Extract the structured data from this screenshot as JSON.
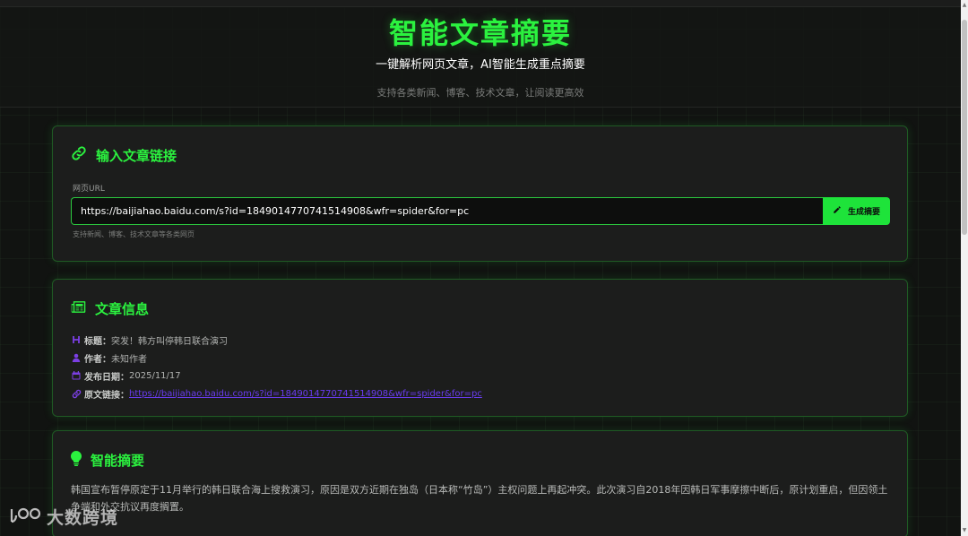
{
  "hero": {
    "title": "智能文章摘要",
    "subtitle": "一键解析网页文章，AI智能生成重点摘要",
    "description": "支持各类新闻、博客、技术文章，让阅读更高效"
  },
  "input_card": {
    "title": "输入文章链接",
    "field_label": "网页URL",
    "url_value": "https://baijiahao.baidu.com/s?id=1849014770741514908&wfr=spider&for=pc",
    "button_label": "生成摘要",
    "hint": "支持新闻、博客、技术文章等各类网页"
  },
  "info_card": {
    "title": "文章信息",
    "title_label": "标题：",
    "title_value": "突发！韩方叫停韩日联合演习",
    "author_label": "作者：",
    "author_value": "未知作者",
    "date_label": "发布日期：",
    "date_value": "2025/11/17",
    "link_label": "原文链接：",
    "link_value": "https://baijiahao.baidu.com/s?id=1849014770741514908&wfr=spider&for=pc"
  },
  "summary_card": {
    "title": "智能摘要",
    "text": "韩国宣布暂停原定于11月举行的韩日联合海上搜救演习，原因是双方近期在独岛（日本称“竹岛”）主权问题上再起冲突。此次演习自2018年因韩日军事摩擦中断后，原计划重启，但因领土争端和外交抗议再度搁置。"
  },
  "watermark": {
    "text": "大数跨境"
  },
  "colors": {
    "accent": "#2bf23f",
    "button": "#1ee33a",
    "link": "#6a3cf0",
    "icon_purple": "#7b3fe4",
    "background": "#111311",
    "card": "#1c1d1c"
  }
}
